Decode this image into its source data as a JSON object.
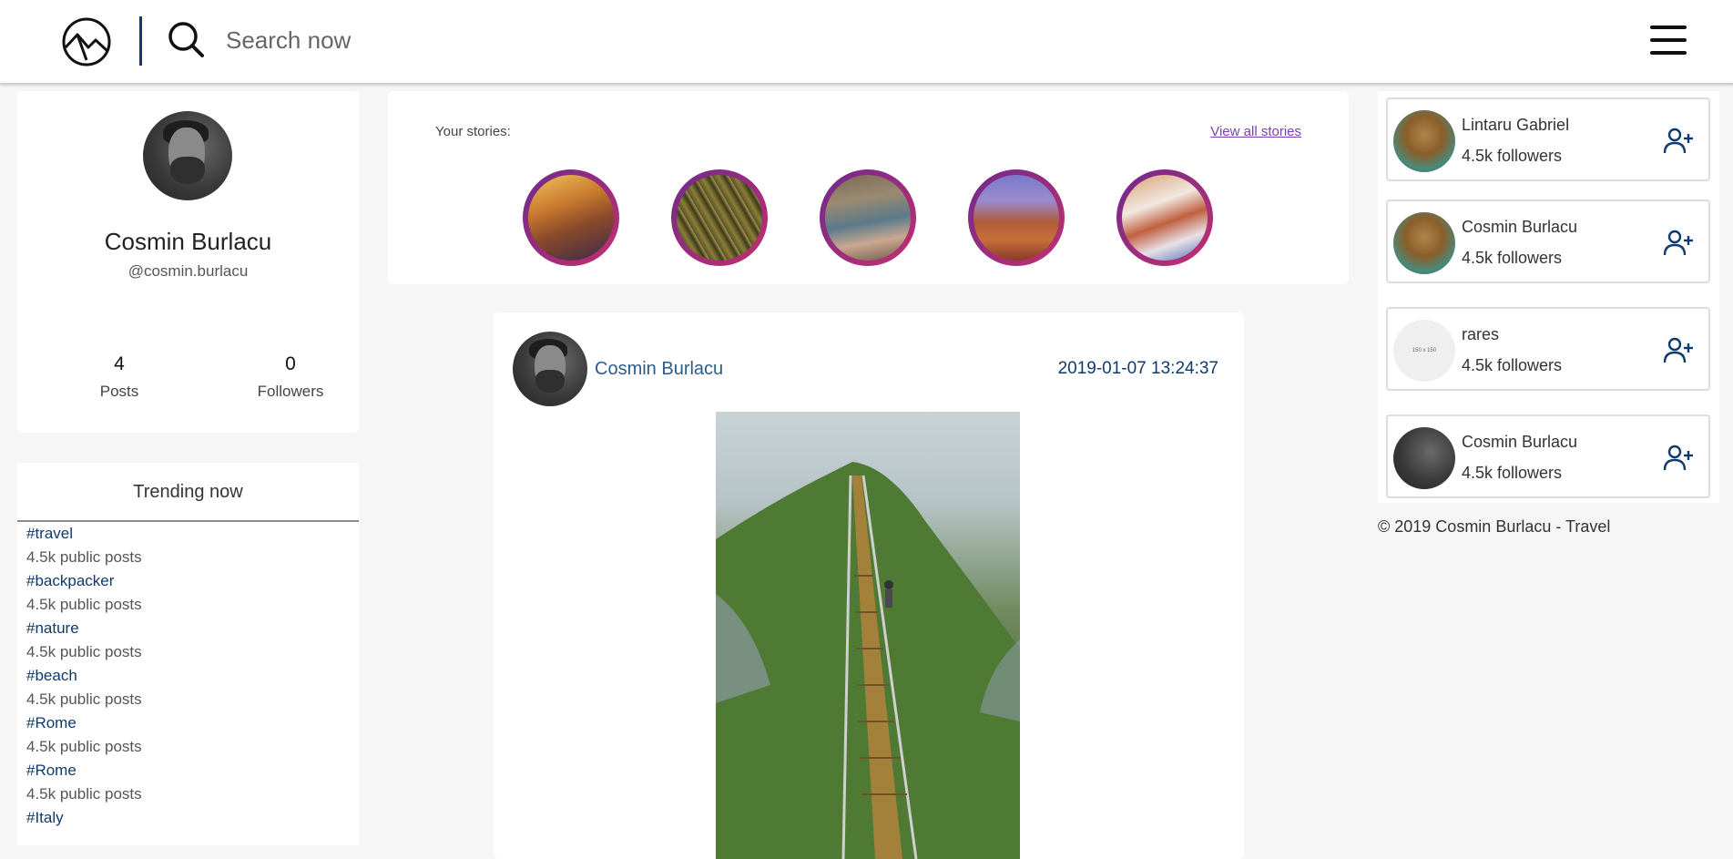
{
  "header": {
    "search_placeholder": "Search now",
    "logo_icon": "mountain-logo-icon",
    "search_icon": "search-icon",
    "menu_icon": "hamburger-menu-icon"
  },
  "profile": {
    "name": "Cosmin Burlacu",
    "handle": "@cosmin.burlacu",
    "posts_value": "4",
    "posts_label": "Posts",
    "followers_value": "0",
    "followers_label": "Followers"
  },
  "trending": {
    "title": "Trending now",
    "items": [
      {
        "tag": "#travel",
        "count": "4.5k public posts"
      },
      {
        "tag": "#backpacker",
        "count": "4.5k public posts"
      },
      {
        "tag": "#nature",
        "count": "4.5k public posts"
      },
      {
        "tag": "#beach",
        "count": "4.5k public posts"
      },
      {
        "tag": "#Rome",
        "count": "4.5k public posts"
      },
      {
        "tag": "#Rome",
        "count": "4.5k public posts"
      },
      {
        "tag": "#Italy",
        "count": ""
      }
    ]
  },
  "stories": {
    "label": "Your stories:",
    "view_all": "View all stories"
  },
  "post": {
    "author": "Cosmin Burlacu",
    "date": "2019-01-07 13:24:37"
  },
  "suggestions": [
    {
      "name": "Lintaru Gabriel",
      "followers": "4.5k followers"
    },
    {
      "name": "Cosmin Burlacu",
      "followers": "4.5k followers"
    },
    {
      "name": "rares",
      "followers": "4.5k followers",
      "placeholder_text": "150 x 150"
    },
    {
      "name": "Cosmin Burlacu",
      "followers": "4.5k followers"
    }
  ],
  "footer": {
    "text": "© 2019 Cosmin Burlacu - Travel"
  },
  "colors": {
    "accent": "#0f3a6b",
    "link": "#2d5c8c",
    "story_ring_start": "#6f2a8e",
    "story_ring_end": "#c2306e",
    "view_all_link": "#7a3fb0"
  }
}
